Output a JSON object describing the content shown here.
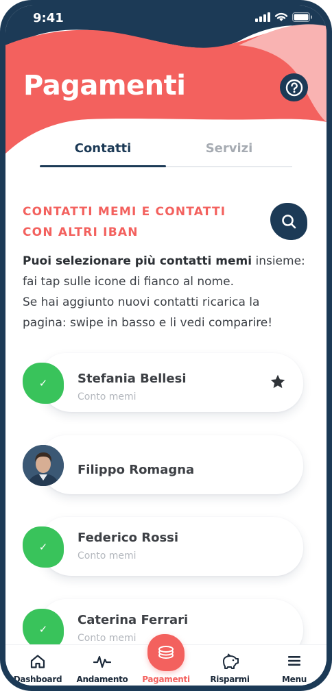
{
  "status_bar": {
    "time": "9:41"
  },
  "header": {
    "title": "Pagamenti"
  },
  "tabs": [
    {
      "label": "Contatti",
      "active": true
    },
    {
      "label": "Servizi",
      "active": false
    }
  ],
  "section": {
    "title_line1": "CONTATTI MEMI E CONTATTI",
    "title_line2": "CON ALTRI IBAN",
    "description_bold": "Puoi selezionare più contatti memi",
    "description_rest1": " insieme:",
    "description_line2": "fai tap sulle icone di fianco al nome.",
    "description_line3": "Se hai aggiunto nuovi contatti ricarica la",
    "description_line4": "pagina: swipe in basso e li vedi comparire!"
  },
  "contacts": [
    {
      "name": "Stefania Bellesi",
      "subtitle": "Conto memi",
      "avatar": "check-icon",
      "favorite": true
    },
    {
      "name": "Filippo Romagna",
      "subtitle": "",
      "avatar": "photo",
      "favorite": false
    },
    {
      "name": "Federico Rossi",
      "subtitle": "Conto memi",
      "avatar": "check-icon",
      "favorite": false
    },
    {
      "name": "Caterina Ferrari",
      "subtitle": "Conto memi",
      "avatar": "check-icon",
      "favorite": false
    }
  ],
  "bottom_nav": [
    {
      "label": "Dashboard",
      "icon": "home-icon",
      "active": false
    },
    {
      "label": "Andamento",
      "icon": "pulse-icon",
      "active": false
    },
    {
      "label": "Pagamenti",
      "icon": "coins-icon",
      "active": true
    },
    {
      "label": "Risparmi",
      "icon": "piggy-bank-icon",
      "active": false
    },
    {
      "label": "Menu",
      "icon": "menu-icon",
      "active": false
    }
  ],
  "colors": {
    "accent": "#f3615e",
    "navy": "#1c3a56",
    "green": "#39c35b",
    "header_light": "#f9b3b2"
  }
}
